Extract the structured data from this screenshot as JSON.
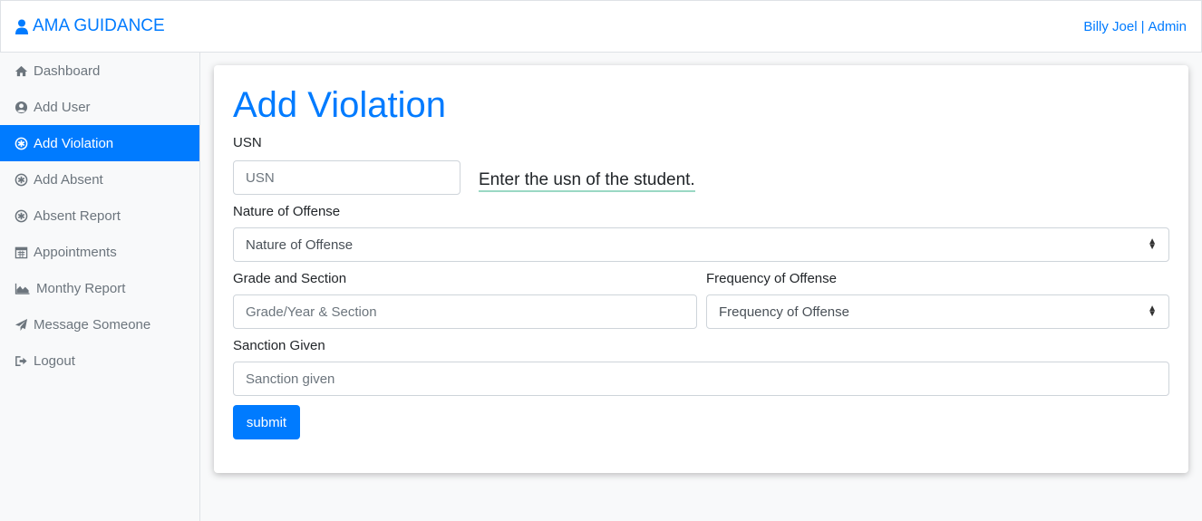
{
  "navbar": {
    "brand": "AMA GUIDANCE",
    "user": "Billy Joel",
    "separator": "|",
    "role": "Admin"
  },
  "sidebar": {
    "items": [
      {
        "label": "Dashboard",
        "icon": "home-icon"
      },
      {
        "label": "Add User",
        "icon": "user-circle-icon"
      },
      {
        "label": "Add Violation",
        "icon": "asterisk-circle-icon",
        "active": true
      },
      {
        "label": "Add Absent",
        "icon": "asterisk-circle-icon"
      },
      {
        "label": "Absent Report",
        "icon": "asterisk-circle-icon"
      },
      {
        "label": "Appointments",
        "icon": "calendar-icon"
      },
      {
        "label": "Monthy Report",
        "icon": "area-chart-icon"
      },
      {
        "label": "Message Someone",
        "icon": "paper-plane-icon"
      },
      {
        "label": "Logout",
        "icon": "sign-out-icon"
      }
    ]
  },
  "form": {
    "title": "Add Violation",
    "usn_label": "USN",
    "usn_placeholder": "USN",
    "usn_hint": "Enter the usn of the student.",
    "offense_label": "Nature of Offense",
    "offense_value": "Nature of Offense",
    "grade_label": "Grade and Section",
    "grade_placeholder": "Grade/Year & Section",
    "frequency_label": "Frequency of Offense",
    "frequency_value": "Frequency of Offense",
    "sanction_label": "Sanction Given",
    "sanction_placeholder": "Sanction given",
    "submit_label": "submit"
  },
  "colors": {
    "accent": "#007bff",
    "muted": "#6c757d",
    "background": "#f8f9fa"
  }
}
